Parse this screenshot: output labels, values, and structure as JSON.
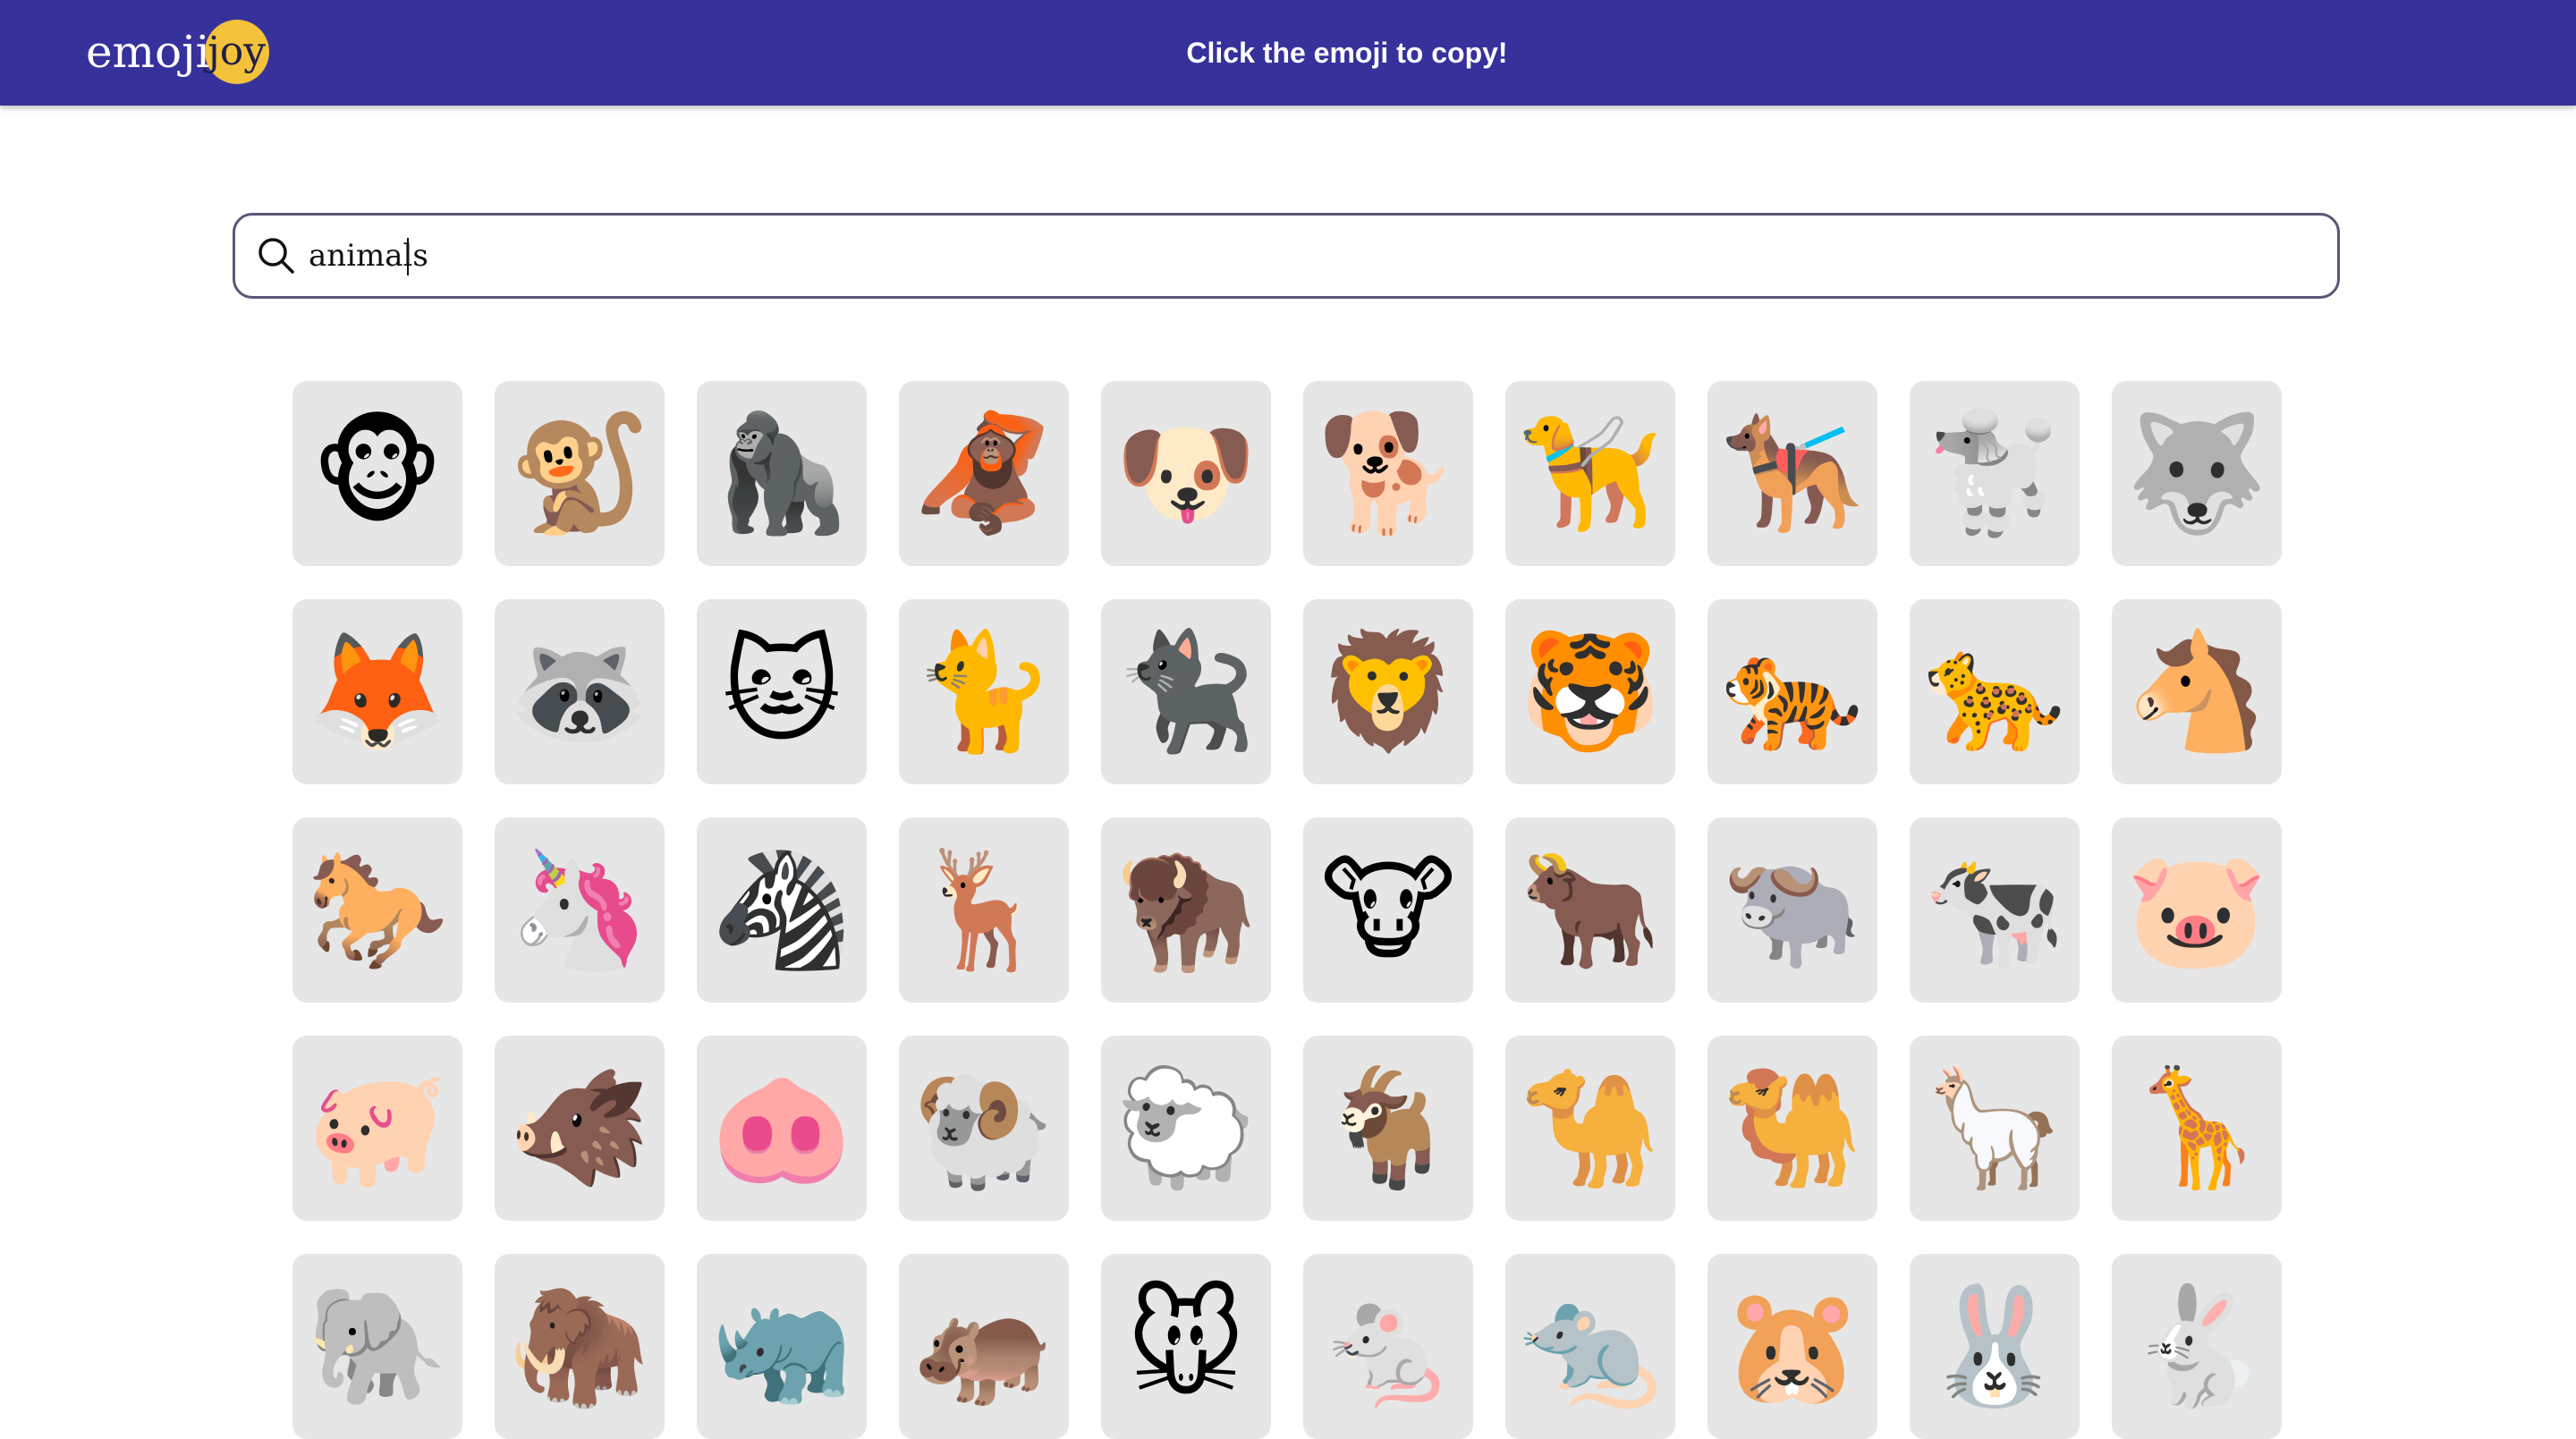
{
  "header": {
    "logo_text": "emoji",
    "logo_badge": "joy",
    "tagline": "Click the emoji to copy!",
    "bg_color": "#37319c",
    "badge_color": "#f3c13a"
  },
  "search": {
    "value": "animals",
    "icon": "search-icon"
  },
  "emojis": [
    "🐵",
    "🐒",
    "🦍",
    "🦧",
    "🐶",
    "🐕",
    "🦮",
    "🐕‍🦺",
    "🐩",
    "🐺",
    "🦊",
    "🦝",
    "🐱",
    "🐈",
    "🐈‍⬛",
    "🦁",
    "🐯",
    "🐅",
    "🐆",
    "🐴",
    "🐎",
    "🦄",
    "🦓",
    "🦌",
    "🦬",
    "🐮",
    "🐂",
    "🐃",
    "🐄",
    "🐷",
    "🐖",
    "🐗",
    "🐽",
    "🐏",
    "🐑",
    "🐐",
    "🐪",
    "🐫",
    "🦙",
    "🦒",
    "🐘",
    "🦣",
    "🦏",
    "🦛",
    "🐭",
    "🐁",
    "🐀",
    "🐹",
    "🐰",
    "🐇"
  ],
  "tile_color": "#e6e6e6"
}
